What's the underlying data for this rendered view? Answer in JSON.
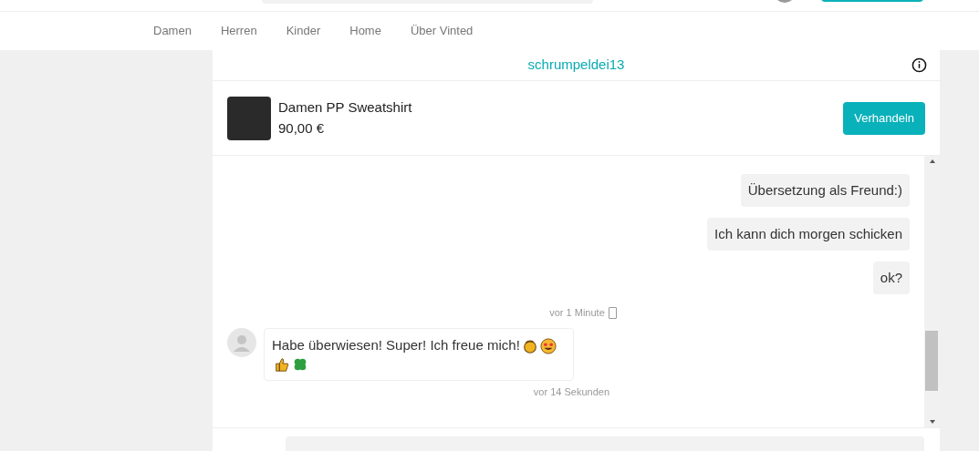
{
  "nav": [
    {
      "label": "Damen"
    },
    {
      "label": "Herren"
    },
    {
      "label": "Kinder"
    },
    {
      "label": "Home"
    },
    {
      "label": "Über Vinted"
    }
  ],
  "conversation": {
    "username": "schrumpeldei13"
  },
  "item": {
    "title": "Damen PP Sweatshirt",
    "price": "90,00 €",
    "button": "Verhandeln"
  },
  "messages": [
    {
      "kind": "own",
      "text": "Übersetzung als Freund:)"
    },
    {
      "kind": "own",
      "text": "Ich kann dich morgen schicken"
    },
    {
      "kind": "own",
      "text": "ok?"
    },
    {
      "kind": "time",
      "text": "vor 1 Minute",
      "device_icon": true
    },
    {
      "kind": "other",
      "text": "Habe überwiesen! Super! Ich freue mich!",
      "emoji": [
        {
          "kind": "clap"
        },
        {
          "kind": "heart-eyes"
        },
        {
          "kind": "thumbs-up"
        },
        {
          "kind": "clover"
        }
      ]
    },
    {
      "kind": "time",
      "text": "vor 14 Sekunden",
      "device_icon": false
    }
  ]
}
